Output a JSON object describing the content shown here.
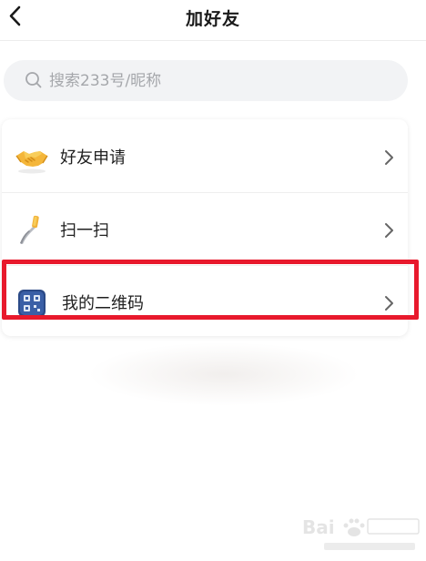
{
  "header": {
    "title": "加好友"
  },
  "search": {
    "placeholder": "搜索233号/昵称"
  },
  "menu": {
    "items": [
      {
        "label": "好友申请",
        "icon": "handshake-icon"
      },
      {
        "label": "扫一扫",
        "icon": "scan-icon"
      },
      {
        "label": "我的二维码",
        "icon": "qr-code-icon"
      }
    ]
  },
  "colors": {
    "highlight": "#e8192c",
    "search_bg": "#f2f3f5",
    "qr_icon_bg": "#2b4a87"
  }
}
